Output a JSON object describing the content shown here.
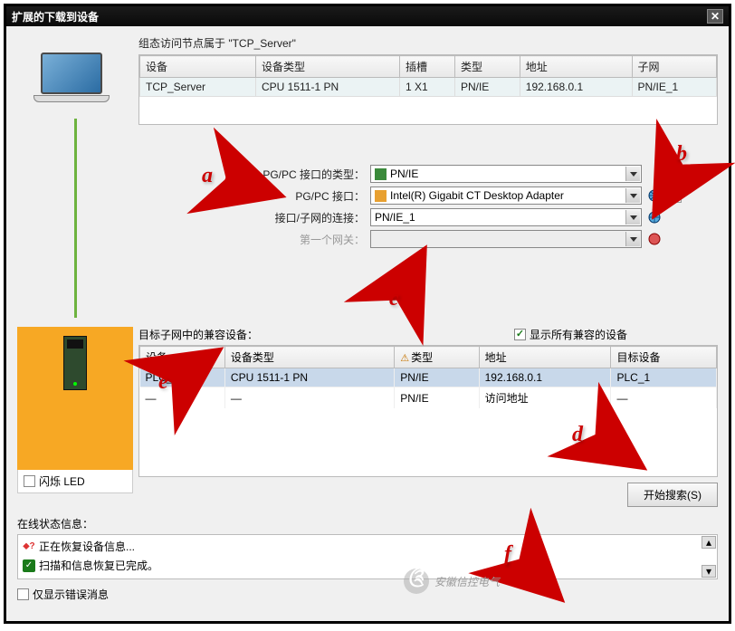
{
  "title": "扩展的下载到设备",
  "config_nodes_label": "组态访问节点属于 \"TCP_Server\"",
  "top_table": {
    "headers": [
      "设备",
      "设备类型",
      "插槽",
      "类型",
      "地址",
      "子网"
    ],
    "row": [
      "TCP_Server",
      "CPU 1511-1 PN",
      "1 X1",
      "PN/IE",
      "192.168.0.1",
      "PN/IE_1"
    ]
  },
  "form": {
    "pgpc_type_label": "PG/PC 接口的类型：",
    "pgpc_type_value": "PN/IE",
    "pgpc_if_label": "PG/PC 接口：",
    "pgpc_if_value": "Intel(R) Gigabit CT Desktop Adapter",
    "if_subnet_label": "接口/子网的连接：",
    "if_subnet_value": "PN/IE_1",
    "first_gw_label": "第一个网关："
  },
  "compat": {
    "title": "目标子网中的兼容设备：",
    "show_all_label": "显示所有兼容的设备",
    "headers": [
      "设备",
      "设备类型",
      "类型",
      "地址",
      "目标设备"
    ],
    "rows": [
      [
        "PLC_1",
        "CPU 1511-1 PN",
        "PN/IE",
        "192.168.0.1",
        "PLC_1"
      ],
      [
        "—",
        "—",
        "PN/IE",
        "访问地址",
        "—"
      ]
    ]
  },
  "blink_led_label": "闪烁 LED",
  "start_search_btn": "开始搜索(S)",
  "status": {
    "title": "在线状态信息：",
    "lines": [
      "正在恢复设备信息...",
      "扫描和信息恢复已完成。"
    ],
    "only_errors_label": "仅显示错误消息"
  },
  "watermark": "安徽信控电气",
  "annotations": {
    "a": "a",
    "b": "b",
    "c": "c",
    "d": "d",
    "e": "e",
    "f": "f"
  }
}
